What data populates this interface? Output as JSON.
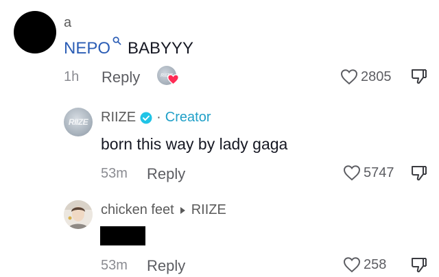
{
  "comment": {
    "username": "a",
    "mention": "NEPO",
    "text": "BABYYY",
    "time": "1h",
    "reply_label": "Reply",
    "likes": "2805",
    "creator_liked_avatar_text": "RIIZE"
  },
  "replies": [
    {
      "username": "RIIZE",
      "separator": "·",
      "badge": "Creator",
      "avatar_text": "RIIZE",
      "text": "born this way by lady gaga",
      "time": "53m",
      "reply_label": "Reply",
      "likes": "5747"
    },
    {
      "username": "chicken feet",
      "reply_to": "RIIZE",
      "time": "53m",
      "reply_label": "Reply",
      "likes": "258"
    }
  ],
  "colors": {
    "mention": "#2b5db5",
    "creator": "#20a0c8",
    "verified": "#20c4e6",
    "heart": "#fe2c55"
  },
  "icons": [
    "search-icon",
    "heart-outline-icon",
    "thumbs-down-icon",
    "verified-icon",
    "triangle-right-icon",
    "heart-filled-icon"
  ]
}
